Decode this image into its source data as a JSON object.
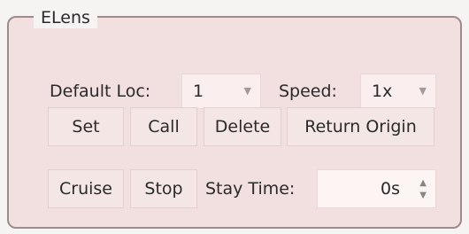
{
  "group": {
    "title": "ELens"
  },
  "row1": {
    "default_loc_label": "Default Loc:",
    "default_loc_value": "1",
    "speed_label": "Speed:",
    "speed_value": "1x"
  },
  "row2": {
    "set_label": "Set",
    "call_label": "Call",
    "delete_label": "Delete",
    "return_origin_label": "Return Origin"
  },
  "row3": {
    "cruise_label": "Cruise",
    "stop_label": "Stop",
    "stay_time_label": "Stay Time:",
    "stay_time_value": "0s"
  },
  "icons": {
    "dropdown": "chevron-down-icon",
    "spin_up": "arrow-up-icon",
    "spin_down": "arrow-down-icon"
  }
}
